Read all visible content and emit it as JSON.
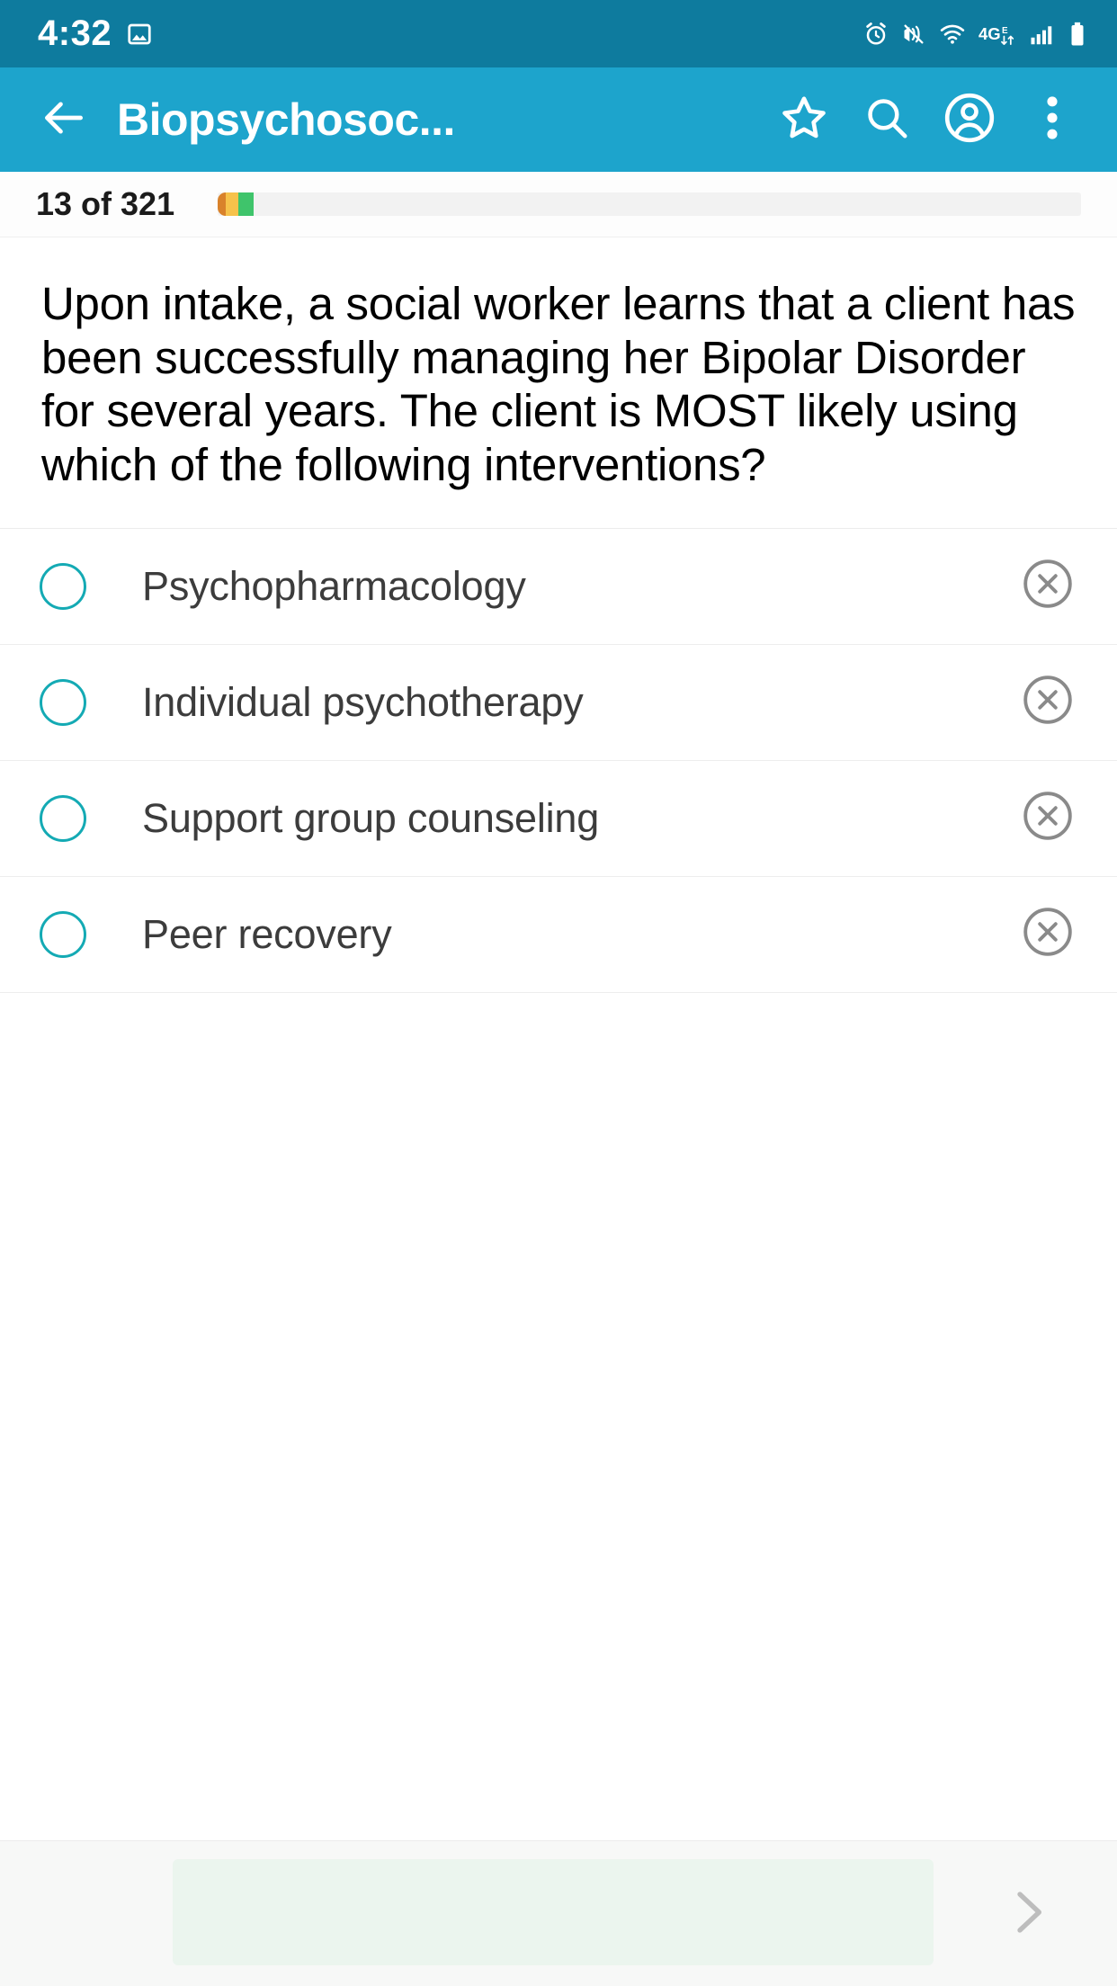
{
  "status_bar": {
    "time": "4:32",
    "left_icons": [
      "image-icon"
    ],
    "right_icons": [
      "alarm-icon",
      "vibrate-icon",
      "wifi-icon",
      "network-4g-icon",
      "cellular-signal-icon",
      "battery-icon"
    ],
    "background_color": "#0E7B9E"
  },
  "app_bar": {
    "back_label": "back-arrow",
    "title": "Biopsychosoc...",
    "actions": [
      {
        "name": "star-icon",
        "label": "Favorite"
      },
      {
        "name": "search-icon",
        "label": "Search"
      },
      {
        "name": "account-circle-icon",
        "label": "Account"
      },
      {
        "name": "overflow-menu-icon",
        "label": "More options"
      }
    ],
    "background_color": "#1DA4CC"
  },
  "progress": {
    "label": "13 of 321",
    "current": 13,
    "total": 321,
    "segments": [
      {
        "name": "incorrect",
        "color": "#D9822B"
      },
      {
        "name": "flagged",
        "color": "#F6C24B"
      },
      {
        "name": "correct",
        "color": "#3FC46B"
      }
    ],
    "track_color": "#f2f2f2"
  },
  "question": {
    "text": "Upon intake, a social worker learns that a client has been successfully managing her Bipolar Disorder for several years. The client is MOST likely using which of the following interventions?"
  },
  "options": [
    {
      "label": "Psychopharmacology",
      "selected": false,
      "eliminated": false,
      "eliminate_icon": "close-circle-icon"
    },
    {
      "label": "Individual psychotherapy",
      "selected": false,
      "eliminated": false,
      "eliminate_icon": "close-circle-icon"
    },
    {
      "label": "Support group counseling",
      "selected": false,
      "eliminated": false,
      "eliminate_icon": "close-circle-icon"
    },
    {
      "label": "Peer recovery",
      "selected": false,
      "eliminated": false,
      "eliminate_icon": "close-circle-icon"
    }
  ],
  "bottom_bar": {
    "submit_label": "",
    "submit_color": "#EBF5EE",
    "next_icon": "chevron-right-icon",
    "background_color": "#f7f8f7"
  },
  "theme": {
    "accent": "#1DA4CC",
    "status_bar": "#0E7B9E",
    "radio_outline": "#14AAB4",
    "eliminate_gray": "#8a8a8a"
  }
}
